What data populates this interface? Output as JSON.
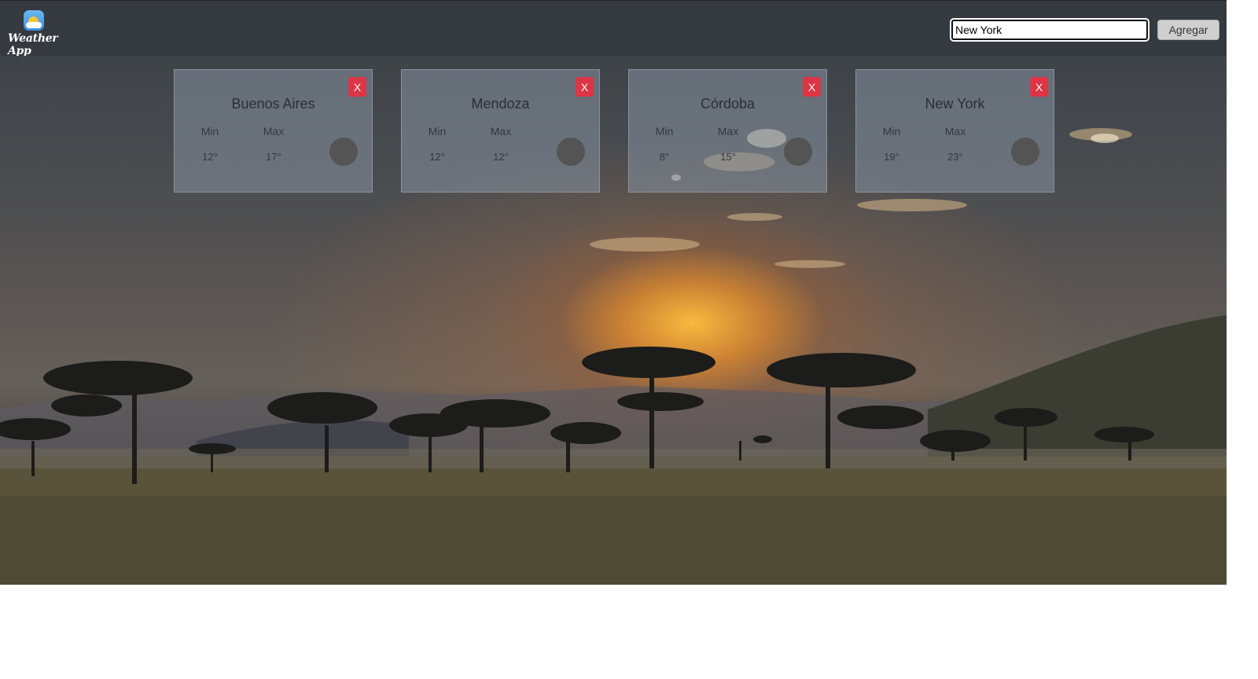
{
  "app": {
    "brand": "Weather App",
    "logo_icon": "sun-behind-cloud-icon"
  },
  "search": {
    "value": "New York",
    "button_label": "Agregar"
  },
  "colors": {
    "navbar": "#353940",
    "close_button": "#dc3545",
    "card_background": "rgba(135,145,160,0.55)"
  },
  "cards": [
    {
      "city": "Buenos Aires",
      "min_label": "Min",
      "max_label": "Max",
      "min": "12°",
      "max": "17°",
      "close_label": "X"
    },
    {
      "city": "Mendoza",
      "min_label": "Min",
      "max_label": "Max",
      "min": "12°",
      "max": "12°",
      "close_label": "X"
    },
    {
      "city": "Córdoba",
      "min_label": "Min",
      "max_label": "Max",
      "min": "8°",
      "max": "15°",
      "close_label": "X"
    },
    {
      "city": "New York",
      "min_label": "Min",
      "max_label": "Max",
      "min": "19°",
      "max": "23°",
      "close_label": "X"
    }
  ]
}
